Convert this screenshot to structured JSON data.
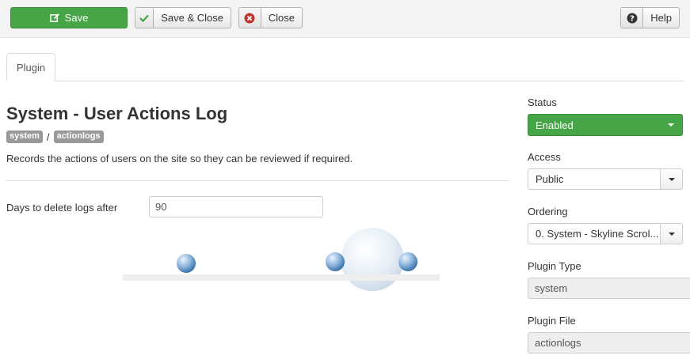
{
  "toolbar": {
    "save_label": "Save",
    "save_close_label": "Save & Close",
    "close_label": "Close",
    "help_label": "Help"
  },
  "tabs": [
    {
      "label": "Plugin"
    }
  ],
  "main": {
    "title": "System - User Actions Log",
    "badges": [
      "system",
      "actionlogs"
    ],
    "badge_separator": "/",
    "description": "Records the actions of users on the site so they can be reviewed if required.",
    "fields": [
      {
        "label": "Days to delete logs after",
        "value": "90"
      }
    ]
  },
  "sidebar": {
    "status": {
      "label": "Status",
      "value": "Enabled"
    },
    "access": {
      "label": "Access",
      "value": "Public"
    },
    "ordering": {
      "label": "Ordering",
      "value": "0. System - Skyline Scrol..."
    },
    "plugin_type": {
      "label": "Plugin Type",
      "value": "system"
    },
    "plugin_file": {
      "label": "Plugin File",
      "value": "actionlogs"
    }
  },
  "colors": {
    "success": "#46a546",
    "danger": "#bd362f",
    "toolbar_bg": "#f3f3f3"
  },
  "icons": {
    "save": "edit-icon",
    "save_close": "check-icon",
    "close": "close-circle-icon",
    "help": "question-icon"
  }
}
